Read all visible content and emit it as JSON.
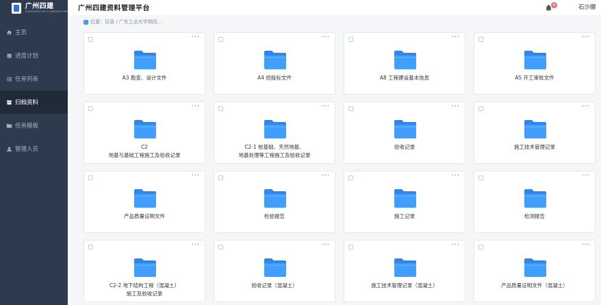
{
  "brand": {
    "title": "广州四建",
    "subtitle": "GUANGZHOU NO.4 CONSTRUCTION"
  },
  "header": {
    "title": "广州四建资料管理平台",
    "notification_count": "6",
    "user_name": "石沙娜"
  },
  "sidebar": {
    "items": [
      {
        "label": "主页",
        "icon": "home-icon",
        "active": false
      },
      {
        "label": "进度计划",
        "icon": "calendar-icon",
        "active": false
      },
      {
        "label": "任务列表",
        "icon": "list-icon",
        "active": false
      },
      {
        "label": "归档资料",
        "icon": "archive-icon",
        "active": true
      },
      {
        "label": "任务模板",
        "icon": "folder-icon",
        "active": false
      },
      {
        "label": "管理人员",
        "icon": "user-icon",
        "active": false
      }
    ]
  },
  "breadcrumb": {
    "text": "位置：目录 / 广东工业大学揭阳..."
  },
  "folders": [
    {
      "label": "A3 勘查、设计文件"
    },
    {
      "label": "A4 招投标文件"
    },
    {
      "label": "A8 工程建设基本信息"
    },
    {
      "label": "A5 开工审批文件"
    },
    {
      "label": "C2\n地基与基础工程施工及验收记录"
    },
    {
      "label": "C2-1 桩基础、天然地基、\n地基处理等工程施工及验收记录"
    },
    {
      "label": "验收记录"
    },
    {
      "label": "施工技术管理记录"
    },
    {
      "label": "产品质量证明文件"
    },
    {
      "label": "检验报告"
    },
    {
      "label": "施工记录"
    },
    {
      "label": "检测报告"
    },
    {
      "label": "C2-2 地下结构工程（混凝土）\n施工及验收记录"
    },
    {
      "label": "验收记录（混凝土）"
    },
    {
      "label": "施工技术管理记录（混凝土）"
    },
    {
      "label": "产品质量证明文件（混凝土）"
    }
  ],
  "colors": {
    "sidebar": "#2e3a4e",
    "sidebar_active": "#212a39",
    "folder": "#409eff",
    "badge": "#f56c6c"
  }
}
